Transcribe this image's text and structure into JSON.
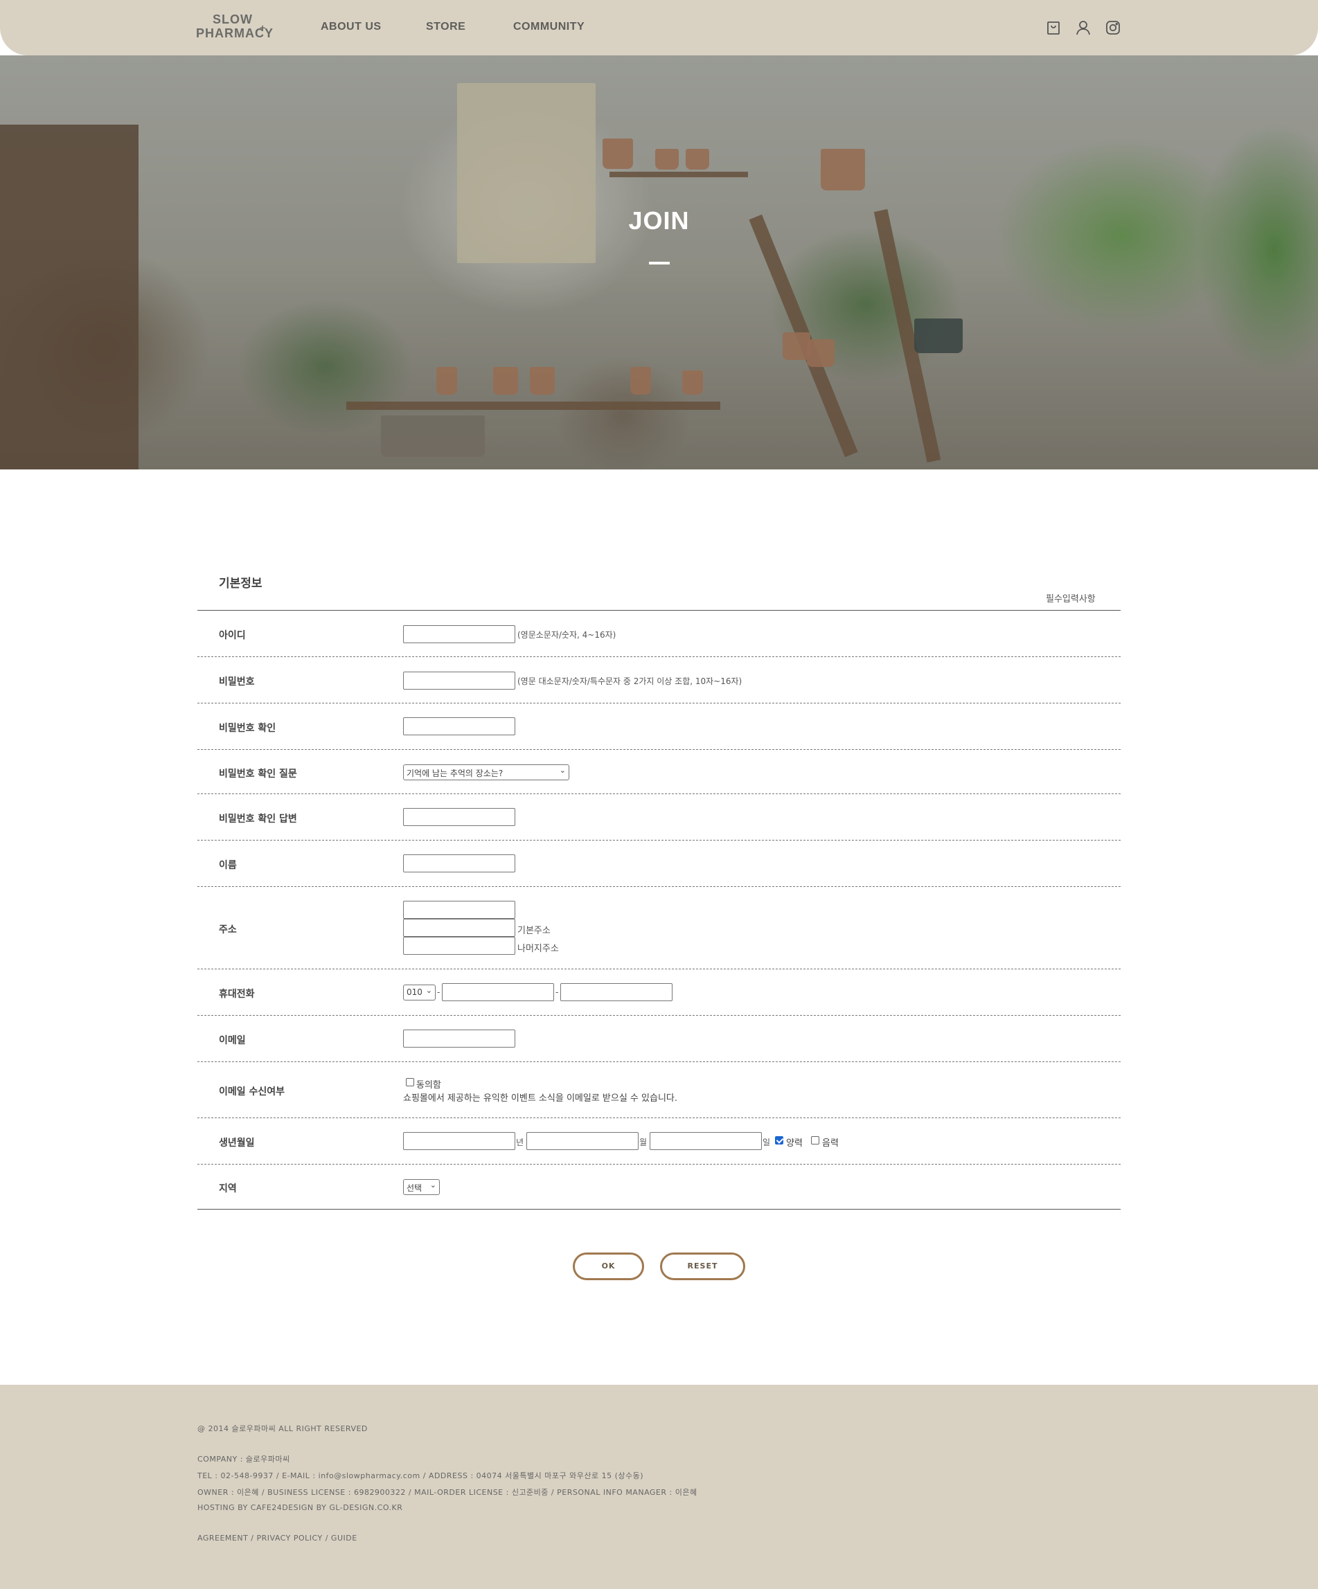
{
  "header": {
    "logo_line1": "SLOW",
    "logo_line2": "PHARMACY",
    "logo_mark": "+",
    "nav": [
      "ABOUT US",
      "STORE",
      "COMMUNITY"
    ],
    "icons": [
      "bag-icon",
      "user-icon",
      "instagram-icon"
    ]
  },
  "hero": {
    "title": "JOIN"
  },
  "form": {
    "section_title": "기본정보",
    "required_note": "필수입력사항",
    "rows": {
      "id": {
        "label": "아이디",
        "hint": "(영문소문자/숫자, 4~16자)"
      },
      "password": {
        "label": "비밀번호",
        "hint": "(영문 대소문자/숫자/특수문자 중 2가지 이상 조합, 10자~16자)"
      },
      "password_confirm": {
        "label": "비밀번호 확인"
      },
      "question": {
        "label": "비밀번호 확인 질문",
        "selected": "기억에 남는 추억의 장소는?"
      },
      "answer": {
        "label": "비밀번호 확인 답변"
      },
      "name": {
        "label": "이름"
      },
      "address": {
        "label": "주소",
        "hint_basic": "기본주소",
        "hint_detail": "나머지주소"
      },
      "phone": {
        "label": "휴대전화",
        "prefix": "010",
        "separator": "-"
      },
      "email": {
        "label": "이메일"
      },
      "email_consent": {
        "label": "이메일 수신여부",
        "agree": "동의함",
        "desc": "쇼핑몰에서 제공하는 유익한 이벤트 소식을 이메일로 받으실 수 있습니다."
      },
      "birthday": {
        "label": "생년월일",
        "year": "년",
        "month": "월",
        "day": "일",
        "solar": "양력",
        "lunar": "음력"
      },
      "region": {
        "label": "지역",
        "selected": "선택"
      }
    },
    "buttons": {
      "ok": "OK",
      "reset": "RESET"
    }
  },
  "footer": {
    "copyright": "@ 2014 슬로우파마씨 ALL RIGHT RESERVED",
    "company": "COMPANY : 슬로우파마씨",
    "contact": "TEL : 02-548-9937 / E-MAIL : info@slowpharmacy.com / ADDRESS : 04074 서울특별시 마포구 와우산로 15 (상수동)",
    "license": "OWNER : 이은혜 / BUSINESS LICENSE : 6982900322 / MAIL-ORDER LICENSE : 신고준비중 / PERSONAL INFO MANAGER : 이은혜",
    "hosting": "HOSTING BY CAFE24DESIGN BY GL-DESIGN.CO.KR",
    "links": "AGREEMENT / PRIVACY POLICY / GUIDE"
  },
  "colors": {
    "header_bg": "#d9d2c3",
    "footer_bg": "#d9d2c3",
    "button_border": "#a0784e",
    "checkbox_checked": "#1a66d2"
  }
}
